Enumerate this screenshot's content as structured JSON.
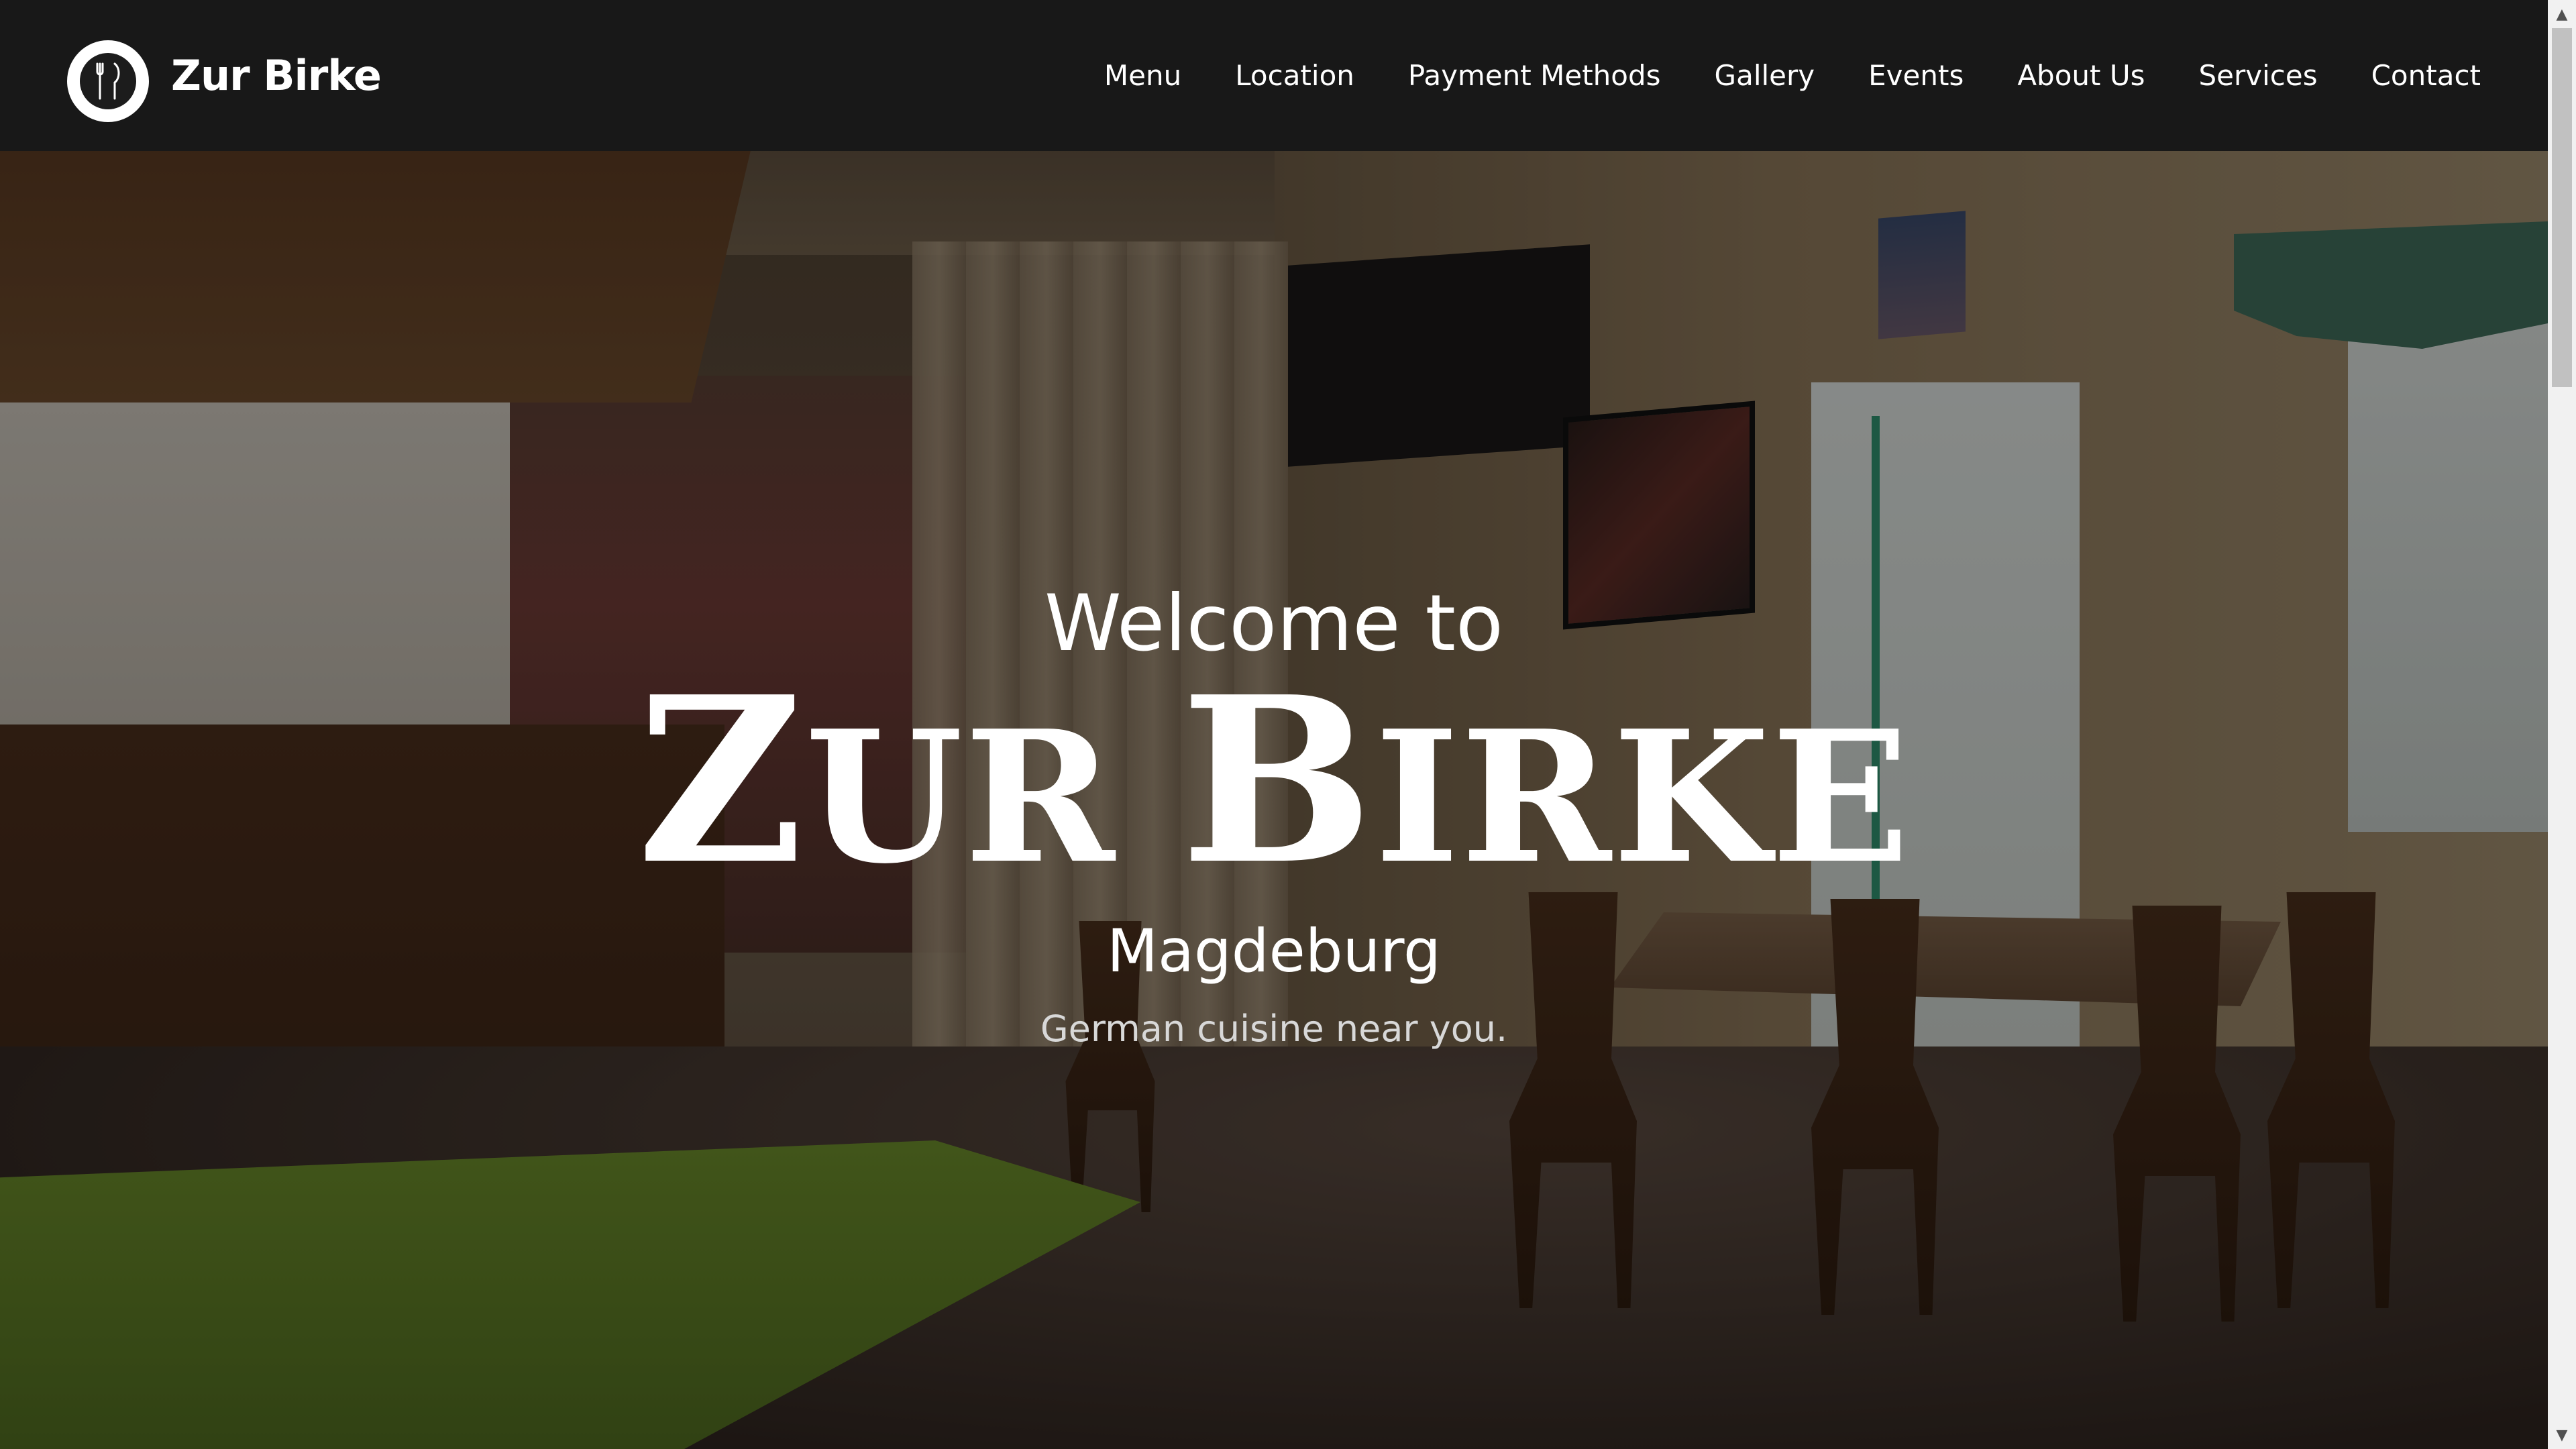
{
  "header": {
    "brand": "Zur Birke",
    "logo_icon": "restaurant-logo-icon"
  },
  "nav": {
    "items": [
      {
        "label": "Menu"
      },
      {
        "label": "Location"
      },
      {
        "label": "Payment Methods"
      },
      {
        "label": "Gallery"
      },
      {
        "label": "Events"
      },
      {
        "label": "About Us"
      },
      {
        "label": "Services"
      },
      {
        "label": "Contact"
      }
    ]
  },
  "hero": {
    "welcome": "Welcome to",
    "title_z": "Z",
    "title_ur": "UR ",
    "title_b": "B",
    "title_irke": "IRKE",
    "city": "Magdeburg",
    "tagline": "German cuisine near you."
  },
  "colors": {
    "header_bg": "#181818",
    "text": "#ffffff",
    "tagline": "#d8d8d8"
  }
}
